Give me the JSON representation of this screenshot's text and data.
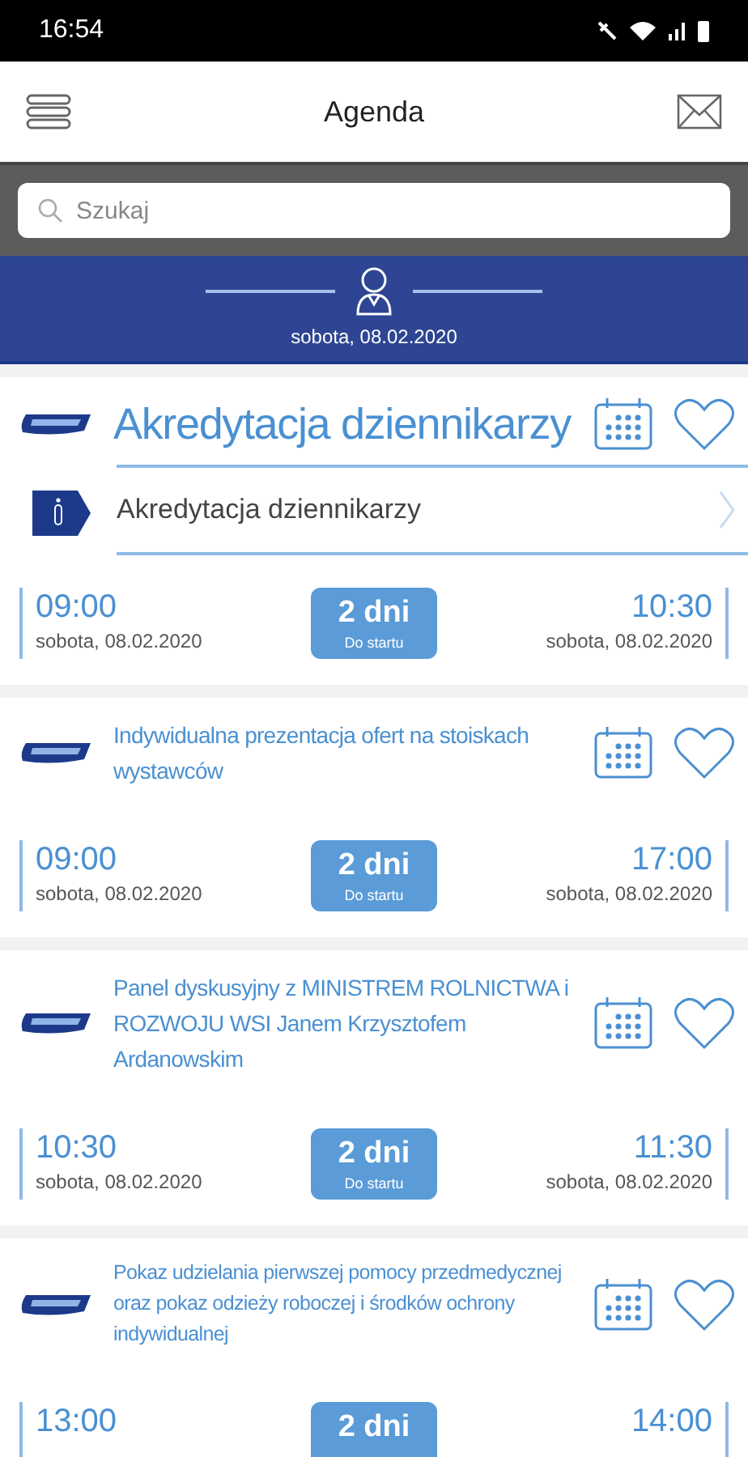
{
  "status_bar": {
    "time": "16:54"
  },
  "header": {
    "title": "Agenda"
  },
  "search": {
    "placeholder": "Szukaj"
  },
  "day_banner": {
    "date": "sobota, 08.02.2020"
  },
  "events": [
    {
      "title": "Akredytacja dziennikarzy",
      "info": "Akredytacja dziennikarzy",
      "start_time": "09:00",
      "start_date": "sobota, 08.02.2020",
      "countdown": "2 dni",
      "countdown_label": "Do startu",
      "end_time": "10:30",
      "end_date": "sobota, 08.02.2020"
    },
    {
      "title": "Indywidualna prezentacja ofert na stoiskach wystawców",
      "start_time": "09:00",
      "start_date": "sobota, 08.02.2020",
      "countdown": "2 dni",
      "countdown_label": "Do startu",
      "end_time": "17:00",
      "end_date": "sobota, 08.02.2020"
    },
    {
      "title": "Panel dyskusyjny z MINISTREM ROLNICTWA i ROZWOJU WSI Janem Krzysztofem Ardanowskim",
      "start_time": "10:30",
      "start_date": "sobota, 08.02.2020",
      "countdown": "2 dni",
      "countdown_label": "Do startu",
      "end_time": "11:30",
      "end_date": "sobota, 08.02.2020"
    },
    {
      "title": "Pokaz udzielania pierwszej pomocy przedmedycznej oraz pokaz odzieży roboczej i środków ochrony indywidualnej",
      "start_time": "13:00",
      "countdown": "2 dni",
      "end_time": "14:00"
    }
  ]
}
